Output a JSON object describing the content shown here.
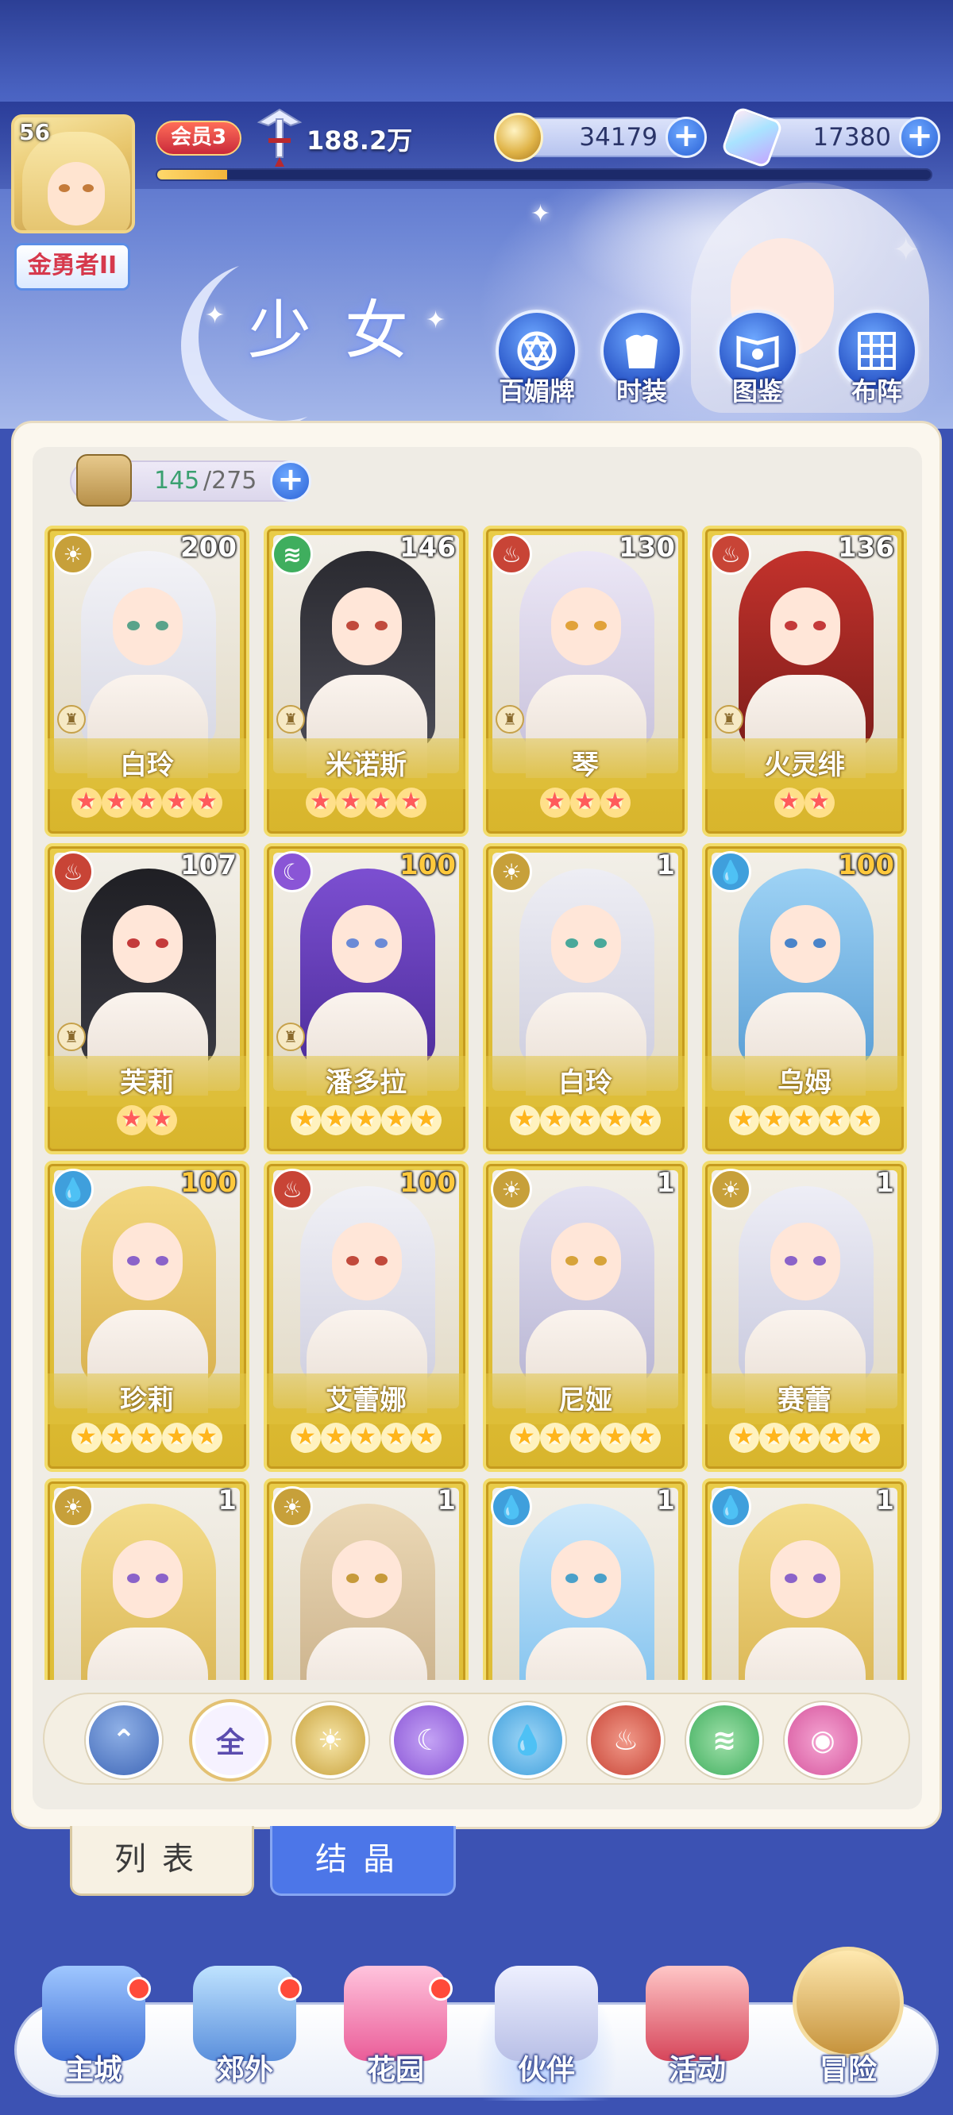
{
  "header": {
    "player_level": "56",
    "rank_title": "金勇者II",
    "vip_label": "会员3",
    "power": "188.2万",
    "exp_progress": 0.09,
    "gold": "34179",
    "diamonds": "17380",
    "page_title": "少女",
    "buttons": [
      {
        "label": "百媚牌",
        "icon": "card-deck-icon"
      },
      {
        "label": "时装",
        "icon": "outfit-icon"
      },
      {
        "label": "图鉴",
        "icon": "codex-book-icon"
      },
      {
        "label": "布阵",
        "icon": "formation-grid-icon"
      }
    ]
  },
  "inventory": {
    "current": "145",
    "separator": "/",
    "max": "275"
  },
  "cards": [
    {
      "name": "白玲",
      "level": "200",
      "element": "light",
      "stars": 5,
      "star_color": "red",
      "job": true
    },
    {
      "name": "米诺斯",
      "level": "146",
      "element": "wind",
      "stars": 4,
      "star_color": "red",
      "job": true
    },
    {
      "name": "琴",
      "level": "130",
      "element": "fire",
      "stars": 3,
      "star_color": "red",
      "job": true
    },
    {
      "name": "火灵绯",
      "level": "136",
      "element": "fire",
      "stars": 2,
      "star_color": "red",
      "job": true
    },
    {
      "name": "芙莉",
      "level": "107",
      "element": "fire",
      "stars": 2,
      "star_color": "red",
      "job": true
    },
    {
      "name": "潘多拉",
      "level": "100",
      "element": "dark",
      "stars": 5,
      "star_color": "gold",
      "job": true
    },
    {
      "name": "白玲",
      "level": "1",
      "element": "light",
      "stars": 5,
      "star_color": "gold",
      "job": false
    },
    {
      "name": "乌姆",
      "level": "100",
      "element": "water",
      "stars": 5,
      "star_color": "gold",
      "job": false
    },
    {
      "name": "珍莉",
      "level": "100",
      "element": "water",
      "stars": 5,
      "star_color": "gold",
      "job": false
    },
    {
      "name": "艾蕾娜",
      "level": "100",
      "element": "fire",
      "stars": 5,
      "star_color": "gold",
      "job": false
    },
    {
      "name": "尼娅",
      "level": "1",
      "element": "light",
      "stars": 5,
      "star_color": "gold",
      "job": false
    },
    {
      "name": "赛蕾",
      "level": "1",
      "element": "light",
      "stars": 5,
      "star_color": "gold",
      "job": false
    },
    {
      "name": "",
      "level": "1",
      "element": "light",
      "stars": 0,
      "star_color": "gold",
      "job": false
    },
    {
      "name": "",
      "level": "1",
      "element": "light",
      "stars": 0,
      "star_color": "gold",
      "job": false
    },
    {
      "name": "",
      "level": "1",
      "element": "water",
      "stars": 0,
      "star_color": "gold",
      "job": false
    },
    {
      "name": "",
      "level": "1",
      "element": "water",
      "stars": 0,
      "star_color": "gold",
      "job": false
    }
  ],
  "filters": [
    {
      "id": "sort",
      "label": "",
      "icon": "sort-toggle-icon"
    },
    {
      "id": "all",
      "label": "全",
      "icon": "all-icon"
    },
    {
      "id": "light",
      "label": "",
      "icon": "sun-element-icon"
    },
    {
      "id": "dark",
      "label": "",
      "icon": "moon-element-icon"
    },
    {
      "id": "water",
      "label": "",
      "icon": "water-element-icon"
    },
    {
      "id": "fire",
      "label": "",
      "icon": "fire-element-icon"
    },
    {
      "id": "wind",
      "label": "",
      "icon": "wind-element-icon"
    },
    {
      "id": "special",
      "label": "",
      "icon": "orb-element-icon"
    }
  ],
  "tabs": {
    "list": "列表",
    "crystal": "结晶"
  },
  "nav": {
    "items": [
      {
        "label": "主城",
        "icon": "castle-icon",
        "badge": true
      },
      {
        "label": "郊外",
        "icon": "portal-gate-icon",
        "badge": true
      },
      {
        "label": "花园",
        "icon": "heart-garden-icon",
        "badge": true
      },
      {
        "label": "伙伴",
        "icon": "partner-portrait-icon",
        "badge": false
      },
      {
        "label": "活动",
        "icon": "gift-box-icon",
        "badge": false
      },
      {
        "label": "冒险",
        "icon": "compass-icon",
        "badge": false
      }
    ]
  },
  "colors": {
    "element_light": "#c7a03a",
    "element_wind": "#3fae5e",
    "element_fire": "#c84436",
    "element_dark": "#8a55d6",
    "element_water": "#3f9fdc",
    "element_special": "#d6559d",
    "card_gold": "#e3c23e",
    "accent_blue": "#3c52b3"
  }
}
